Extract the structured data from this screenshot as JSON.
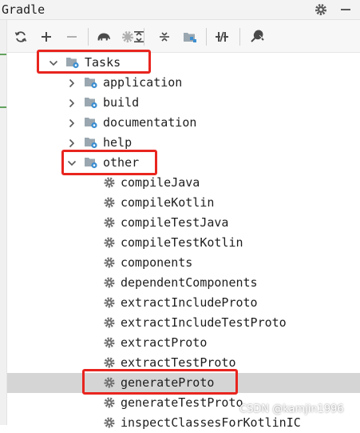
{
  "window": {
    "title": "Gradle"
  },
  "toolbar": {
    "buttons": [
      {
        "icon": "refresh-icon"
      },
      {
        "icon": "plus-icon"
      },
      {
        "icon": "minus-icon"
      },
      {
        "icon": "elephant-icon"
      },
      {
        "icon": "gear-run-icon"
      },
      {
        "icon": "expand-all-icon"
      },
      {
        "icon": "collapse-all-icon"
      },
      {
        "icon": "dependencies-icon"
      },
      {
        "icon": "offline-mode-icon"
      },
      {
        "icon": "wrench-icon"
      }
    ]
  },
  "tree": {
    "root": {
      "label": "Tasks"
    },
    "groups": [
      {
        "label": "application"
      },
      {
        "label": "build"
      },
      {
        "label": "documentation"
      },
      {
        "label": "help"
      },
      {
        "label": "other"
      }
    ],
    "other_tasks": [
      "compileJava",
      "compileKotlin",
      "compileTestJava",
      "compileTestKotlin",
      "components",
      "dependentComponents",
      "extractIncludeProto",
      "extractIncludeTestProto",
      "extractProto",
      "extractTestProto",
      "generateProto",
      "generateTestProto",
      "inspectClassesForKotlinIC"
    ],
    "selected_task": "generateProto"
  },
  "watermark": "CSDN @kamjin1996",
  "colors": {
    "highlight": "#e8251f",
    "selection": "#d5d5d5",
    "gear": "#6e6e6e",
    "accent": "#3d8fd1"
  }
}
